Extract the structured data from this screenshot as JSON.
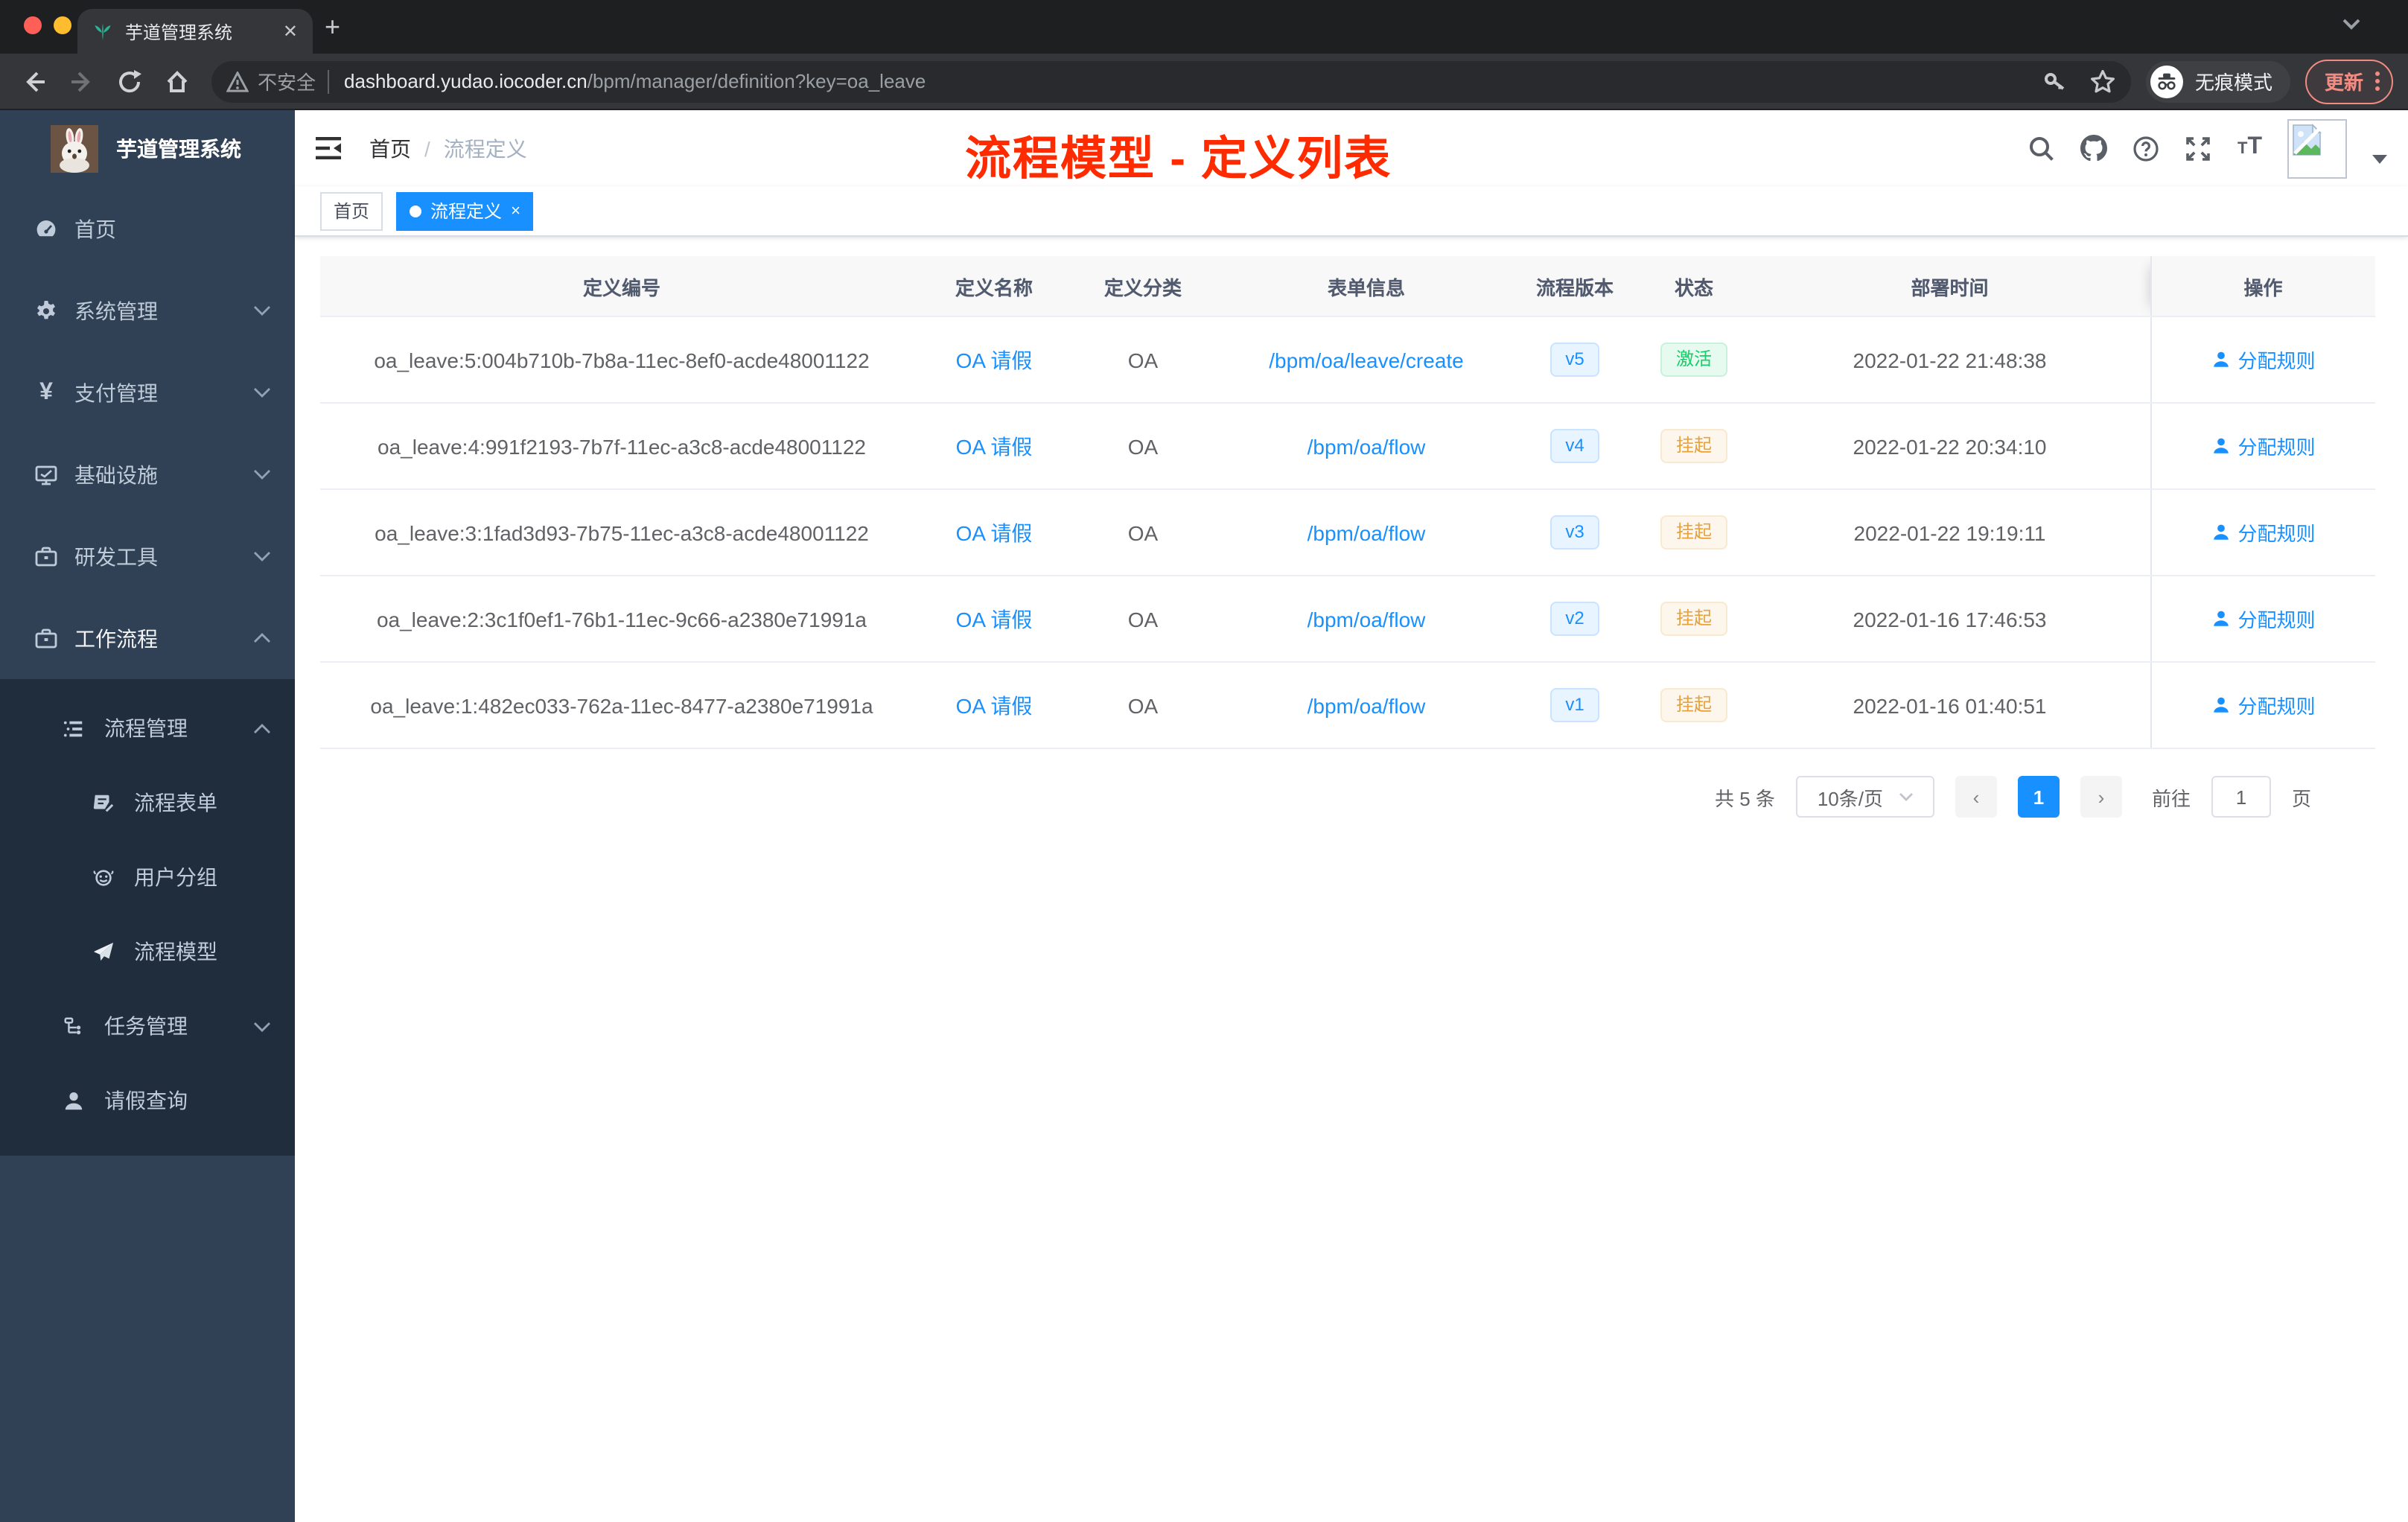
{
  "browser": {
    "tab_title": "芋道管理系统",
    "security_label": "不安全",
    "url_host": "dashboard.yudao.iocoder.cn",
    "url_path": "/bpm/manager/definition?key=oa_leave",
    "incognito_label": "无痕模式",
    "update_label": "更新"
  },
  "sidebar": {
    "app_title": "芋道管理系统",
    "home": "首页",
    "groups": [
      {
        "label": "系统管理"
      },
      {
        "label": "支付管理"
      },
      {
        "label": "基础设施"
      },
      {
        "label": "研发工具"
      },
      {
        "label": "工作流程"
      }
    ],
    "sub": {
      "process_mgmt": "流程管理",
      "process_form": "流程表单",
      "user_group": "用户分组",
      "process_model": "流程模型",
      "task_mgmt": "任务管理",
      "leave_query": "请假查询"
    }
  },
  "header": {
    "breadcrumb_home": "首页",
    "breadcrumb_current": "流程定义",
    "overlay_title": "流程模型 - 定义列表"
  },
  "tags": {
    "home": "首页",
    "active": "流程定义",
    "close": "×"
  },
  "table": {
    "columns": [
      "定义编号",
      "定义名称",
      "定义分类",
      "表单信息",
      "流程版本",
      "状态",
      "部署时间",
      "操作"
    ],
    "rows": [
      {
        "id": "oa_leave:5:004b710b-7b8a-11ec-8ef0-acde48001122",
        "name": "OA 请假",
        "category": "OA",
        "form": "/bpm/oa/leave/create",
        "version": "v5",
        "status": "激活",
        "time": "2022-01-22 21:48:38",
        "action": "分配规则"
      },
      {
        "id": "oa_leave:4:991f2193-7b7f-11ec-a3c8-acde48001122",
        "name": "OA 请假",
        "category": "OA",
        "form": "/bpm/oa/flow",
        "version": "v4",
        "status": "挂起",
        "time": "2022-01-22 20:34:10",
        "action": "分配规则"
      },
      {
        "id": "oa_leave:3:1fad3d93-7b75-11ec-a3c8-acde48001122",
        "name": "OA 请假",
        "category": "OA",
        "form": "/bpm/oa/flow",
        "version": "v3",
        "status": "挂起",
        "time": "2022-01-22 19:19:11",
        "action": "分配规则"
      },
      {
        "id": "oa_leave:2:3c1f0ef1-76b1-11ec-9c66-a2380e71991a",
        "name": "OA 请假",
        "category": "OA",
        "form": "/bpm/oa/flow",
        "version": "v2",
        "status": "挂起",
        "time": "2022-01-16 17:46:53",
        "action": "分配规则"
      },
      {
        "id": "oa_leave:1:482ec033-762a-11ec-8477-a2380e71991a",
        "name": "OA 请假",
        "category": "OA",
        "form": "/bpm/oa/flow",
        "version": "v1",
        "status": "挂起",
        "time": "2022-01-16 01:40:51",
        "action": "分配规则"
      }
    ]
  },
  "pagination": {
    "total": "共 5 条",
    "page_size": "10条/页",
    "prev": "‹",
    "page": "1",
    "next": "›",
    "goto_label": "前往",
    "goto_value": "1",
    "goto_unit": "页"
  },
  "colors": {
    "accent_blue": "#1890ff",
    "status_active_green": "#13ce66",
    "status_suspend_orange": "#e6a23c",
    "overlay_red": "#fe2b00",
    "sidebar_bg": "#304156",
    "submenu_bg": "#1f2d3d"
  },
  "icons": [
    "sprout-favicon",
    "search",
    "github",
    "question",
    "fullscreen",
    "font-size",
    "incognito",
    "key",
    "star",
    "user",
    "dashboard",
    "gear",
    "yen",
    "monitor",
    "briefcase",
    "list-tree",
    "form-edit",
    "user-group",
    "paper-plane",
    "task-tree",
    "person"
  ]
}
